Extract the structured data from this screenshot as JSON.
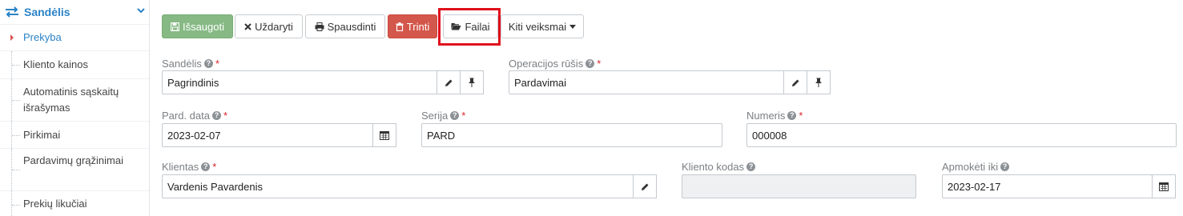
{
  "sidebar": {
    "section_title": "Sandėlis",
    "items": [
      {
        "label": "Prekyba",
        "active": true
      },
      {
        "label": "Kliento kainos",
        "active": false
      },
      {
        "label": "Automatinis sąskaitų išrašymas",
        "active": false
      },
      {
        "label": "Pirkimai",
        "active": false
      },
      {
        "label": "Pardavimų grąžinimai",
        "active": false
      },
      {
        "label": "Prekių likučiai",
        "active": false
      }
    ]
  },
  "toolbar": {
    "save_label": "Išsaugoti",
    "close_label": "Uždaryti",
    "print_label": "Spausdinti",
    "delete_label": "Trinti",
    "files_label": "Failai",
    "more_label": "Kiti veiksmai"
  },
  "form": {
    "warehouse": {
      "label": "Sandėlis",
      "value": "Pagrindinis"
    },
    "operation_type": {
      "label": "Operacijos rūšis",
      "value": "Pardavimai"
    },
    "sale_date": {
      "label": "Pard. data",
      "value": "2023-02-07"
    },
    "series": {
      "label": "Serija",
      "value": "PARD"
    },
    "number": {
      "label": "Numeris",
      "value": "000008"
    },
    "client": {
      "label": "Klientas",
      "value": "Vardenis Pavardenis"
    },
    "client_code": {
      "label": "Kliento kodas",
      "value": ""
    },
    "pay_until": {
      "label": "Apmokėti iki",
      "value": "2023-02-17"
    }
  },
  "colors": {
    "accent": "#2b83c6",
    "save": "#86b984",
    "delete": "#d4574b",
    "highlight": "#e0101c",
    "required": "#d9252c"
  },
  "icons": {
    "sidebar": "arrows-exchange-icon",
    "save": "floppy-icon",
    "close": "times-icon",
    "print": "printer-icon",
    "delete": "trash-icon",
    "files": "folder-open-icon",
    "edit": "pencil-icon",
    "pin": "pin-icon",
    "calendar": "calendar-icon",
    "help": "question-circle-icon"
  }
}
